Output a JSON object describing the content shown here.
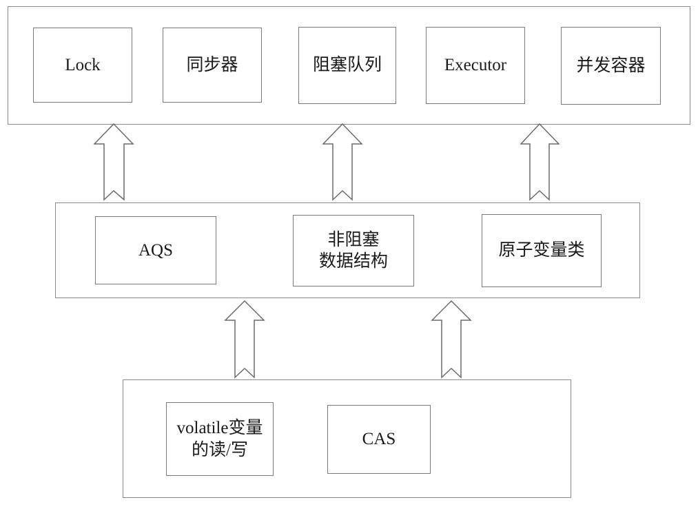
{
  "diagram": {
    "layers": [
      {
        "name": "top-layer",
        "items": [
          "Lock",
          "同步器",
          "阻塞队列",
          "Executor",
          "并发容器"
        ]
      },
      {
        "name": "middle-layer",
        "items": [
          "AQS",
          "非阻塞\n数据结构",
          "原子变量类"
        ],
        "item_lines": [
          [
            "AQS"
          ],
          [
            "非阻塞",
            "数据结构"
          ],
          [
            "原子变量类"
          ]
        ]
      },
      {
        "name": "bottom-layer",
        "items": [
          "volatile变量\n的读/写",
          "CAS"
        ],
        "item_lines": [
          [
            "volatile变量",
            "的读/写"
          ],
          [
            "CAS"
          ]
        ]
      }
    ],
    "arrows": [
      {
        "from": "middle-layer",
        "to": "top-layer",
        "direction": "up"
      },
      {
        "from": "middle-layer",
        "to": "top-layer",
        "direction": "up"
      },
      {
        "from": "middle-layer",
        "to": "top-layer",
        "direction": "up"
      },
      {
        "from": "bottom-layer",
        "to": "middle-layer",
        "direction": "up"
      },
      {
        "from": "bottom-layer",
        "to": "middle-layer",
        "direction": "up"
      }
    ],
    "colors": {
      "border": "#7a7a7a",
      "background": "#ffffff",
      "text": "#1a1a1a"
    }
  }
}
